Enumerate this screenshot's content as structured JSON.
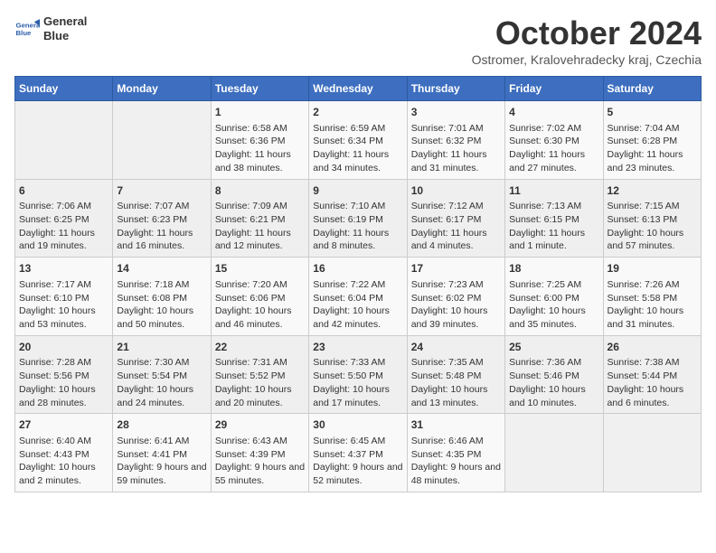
{
  "header": {
    "logo_line1": "General",
    "logo_line2": "Blue",
    "month": "October 2024",
    "location": "Ostromer, Kralovehradecky kraj, Czechia"
  },
  "days_of_week": [
    "Sunday",
    "Monday",
    "Tuesday",
    "Wednesday",
    "Thursday",
    "Friday",
    "Saturday"
  ],
  "weeks": [
    [
      {
        "day": "",
        "info": ""
      },
      {
        "day": "",
        "info": ""
      },
      {
        "day": "1",
        "info": "Sunrise: 6:58 AM\nSunset: 6:36 PM\nDaylight: 11 hours and 38 minutes."
      },
      {
        "day": "2",
        "info": "Sunrise: 6:59 AM\nSunset: 6:34 PM\nDaylight: 11 hours and 34 minutes."
      },
      {
        "day": "3",
        "info": "Sunrise: 7:01 AM\nSunset: 6:32 PM\nDaylight: 11 hours and 31 minutes."
      },
      {
        "day": "4",
        "info": "Sunrise: 7:02 AM\nSunset: 6:30 PM\nDaylight: 11 hours and 27 minutes."
      },
      {
        "day": "5",
        "info": "Sunrise: 7:04 AM\nSunset: 6:28 PM\nDaylight: 11 hours and 23 minutes."
      }
    ],
    [
      {
        "day": "6",
        "info": "Sunrise: 7:06 AM\nSunset: 6:25 PM\nDaylight: 11 hours and 19 minutes."
      },
      {
        "day": "7",
        "info": "Sunrise: 7:07 AM\nSunset: 6:23 PM\nDaylight: 11 hours and 16 minutes."
      },
      {
        "day": "8",
        "info": "Sunrise: 7:09 AM\nSunset: 6:21 PM\nDaylight: 11 hours and 12 minutes."
      },
      {
        "day": "9",
        "info": "Sunrise: 7:10 AM\nSunset: 6:19 PM\nDaylight: 11 hours and 8 minutes."
      },
      {
        "day": "10",
        "info": "Sunrise: 7:12 AM\nSunset: 6:17 PM\nDaylight: 11 hours and 4 minutes."
      },
      {
        "day": "11",
        "info": "Sunrise: 7:13 AM\nSunset: 6:15 PM\nDaylight: 11 hours and 1 minute."
      },
      {
        "day": "12",
        "info": "Sunrise: 7:15 AM\nSunset: 6:13 PM\nDaylight: 10 hours and 57 minutes."
      }
    ],
    [
      {
        "day": "13",
        "info": "Sunrise: 7:17 AM\nSunset: 6:10 PM\nDaylight: 10 hours and 53 minutes."
      },
      {
        "day": "14",
        "info": "Sunrise: 7:18 AM\nSunset: 6:08 PM\nDaylight: 10 hours and 50 minutes."
      },
      {
        "day": "15",
        "info": "Sunrise: 7:20 AM\nSunset: 6:06 PM\nDaylight: 10 hours and 46 minutes."
      },
      {
        "day": "16",
        "info": "Sunrise: 7:22 AM\nSunset: 6:04 PM\nDaylight: 10 hours and 42 minutes."
      },
      {
        "day": "17",
        "info": "Sunrise: 7:23 AM\nSunset: 6:02 PM\nDaylight: 10 hours and 39 minutes."
      },
      {
        "day": "18",
        "info": "Sunrise: 7:25 AM\nSunset: 6:00 PM\nDaylight: 10 hours and 35 minutes."
      },
      {
        "day": "19",
        "info": "Sunrise: 7:26 AM\nSunset: 5:58 PM\nDaylight: 10 hours and 31 minutes."
      }
    ],
    [
      {
        "day": "20",
        "info": "Sunrise: 7:28 AM\nSunset: 5:56 PM\nDaylight: 10 hours and 28 minutes."
      },
      {
        "day": "21",
        "info": "Sunrise: 7:30 AM\nSunset: 5:54 PM\nDaylight: 10 hours and 24 minutes."
      },
      {
        "day": "22",
        "info": "Sunrise: 7:31 AM\nSunset: 5:52 PM\nDaylight: 10 hours and 20 minutes."
      },
      {
        "day": "23",
        "info": "Sunrise: 7:33 AM\nSunset: 5:50 PM\nDaylight: 10 hours and 17 minutes."
      },
      {
        "day": "24",
        "info": "Sunrise: 7:35 AM\nSunset: 5:48 PM\nDaylight: 10 hours and 13 minutes."
      },
      {
        "day": "25",
        "info": "Sunrise: 7:36 AM\nSunset: 5:46 PM\nDaylight: 10 hours and 10 minutes."
      },
      {
        "day": "26",
        "info": "Sunrise: 7:38 AM\nSunset: 5:44 PM\nDaylight: 10 hours and 6 minutes."
      }
    ],
    [
      {
        "day": "27",
        "info": "Sunrise: 6:40 AM\nSunset: 4:43 PM\nDaylight: 10 hours and 2 minutes."
      },
      {
        "day": "28",
        "info": "Sunrise: 6:41 AM\nSunset: 4:41 PM\nDaylight: 9 hours and 59 minutes."
      },
      {
        "day": "29",
        "info": "Sunrise: 6:43 AM\nSunset: 4:39 PM\nDaylight: 9 hours and 55 minutes."
      },
      {
        "day": "30",
        "info": "Sunrise: 6:45 AM\nSunset: 4:37 PM\nDaylight: 9 hours and 52 minutes."
      },
      {
        "day": "31",
        "info": "Sunrise: 6:46 AM\nSunset: 4:35 PM\nDaylight: 9 hours and 48 minutes."
      },
      {
        "day": "",
        "info": ""
      },
      {
        "day": "",
        "info": ""
      }
    ]
  ]
}
